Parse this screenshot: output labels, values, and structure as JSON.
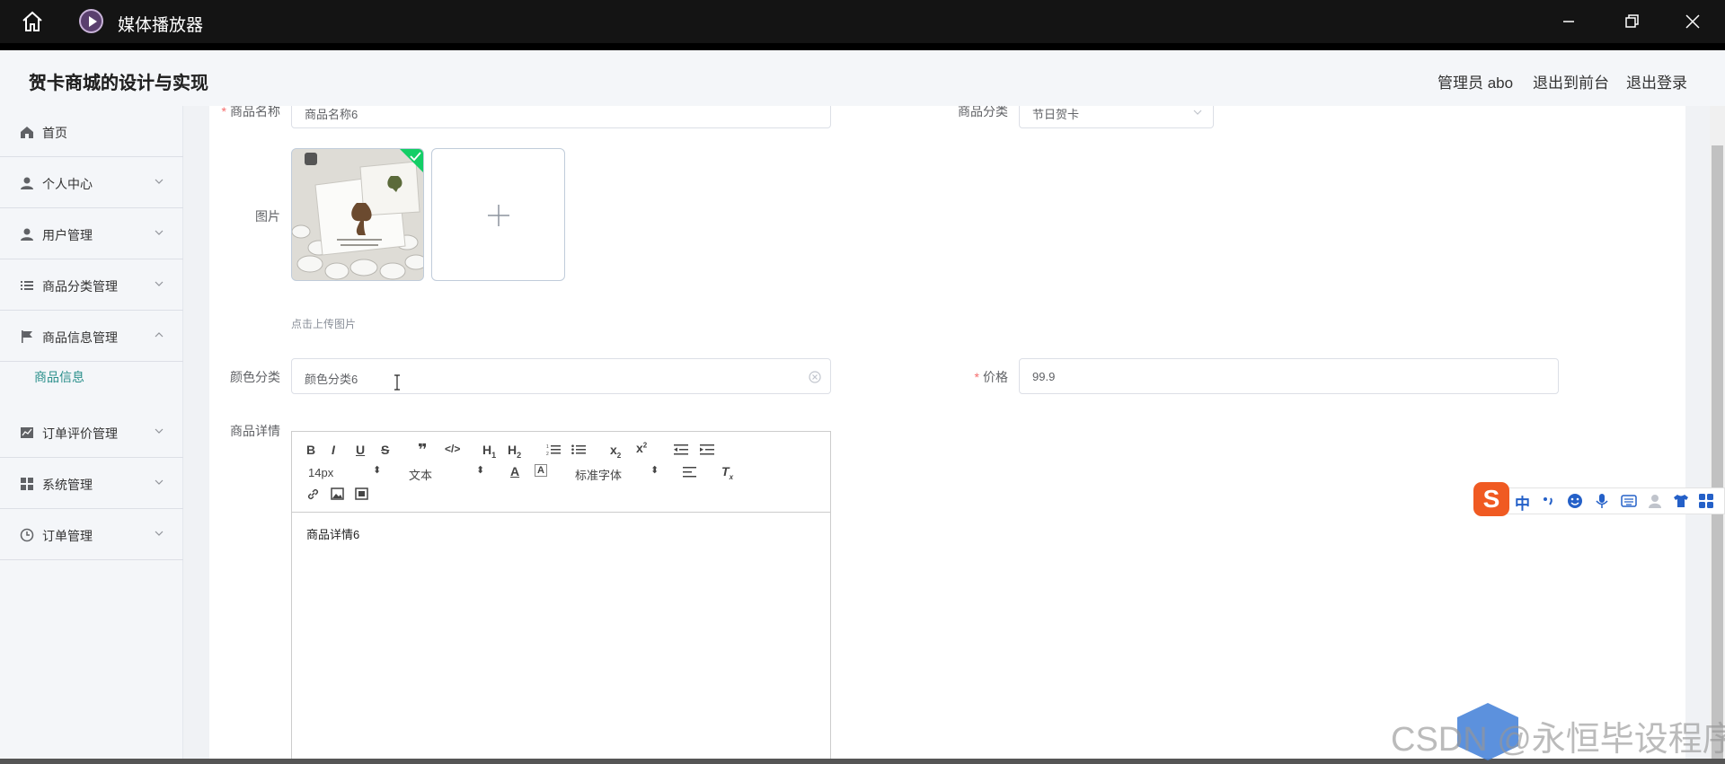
{
  "window": {
    "title": "媒体播放器",
    "icons": [
      "home-icon",
      "media-player-icon",
      "minimize-icon",
      "maximize-icon",
      "close-icon"
    ]
  },
  "header": {
    "brand": "贺卡商城的设计与实现",
    "user": "管理员 abo",
    "front": "退出到前台",
    "logout": "退出登录"
  },
  "sidebar": {
    "items": [
      {
        "label": "首页",
        "icon": "home-icon"
      },
      {
        "label": "个人中心",
        "icon": "user-icon"
      },
      {
        "label": "用户管理",
        "icon": "user-icon"
      },
      {
        "label": "商品分类管理",
        "icon": "list-icon"
      },
      {
        "label": "商品信息管理",
        "icon": "flag-icon",
        "expanded": true
      },
      {
        "label": "订单评价管理",
        "icon": "chart-icon"
      },
      {
        "label": "系统管理",
        "icon": "grid-icon"
      },
      {
        "label": "订单管理",
        "icon": "clock-icon"
      }
    ],
    "subitem": "商品信息"
  },
  "form": {
    "name_label": "商品名称",
    "name_value": "商品名称6",
    "category_label": "商品分类",
    "category_value": "节日贺卡",
    "image_label": "图片",
    "upload_tip": "点击上传图片",
    "color_label": "颜色分类",
    "color_value": "颜色分类6",
    "price_label": "价格",
    "price_value": "99.9",
    "detail_label": "商品详情",
    "detail_content": "商品详情6"
  },
  "editor": {
    "size": "14px",
    "header": "文本",
    "font": "标准字体"
  },
  "ime": {
    "zh": "中",
    "logo": "S"
  },
  "watermark": "CSDN @永恒毕设程序",
  "colors": {
    "accent": "#2a8f8b",
    "required": "#f56c6c",
    "titlebar": "#141414"
  }
}
